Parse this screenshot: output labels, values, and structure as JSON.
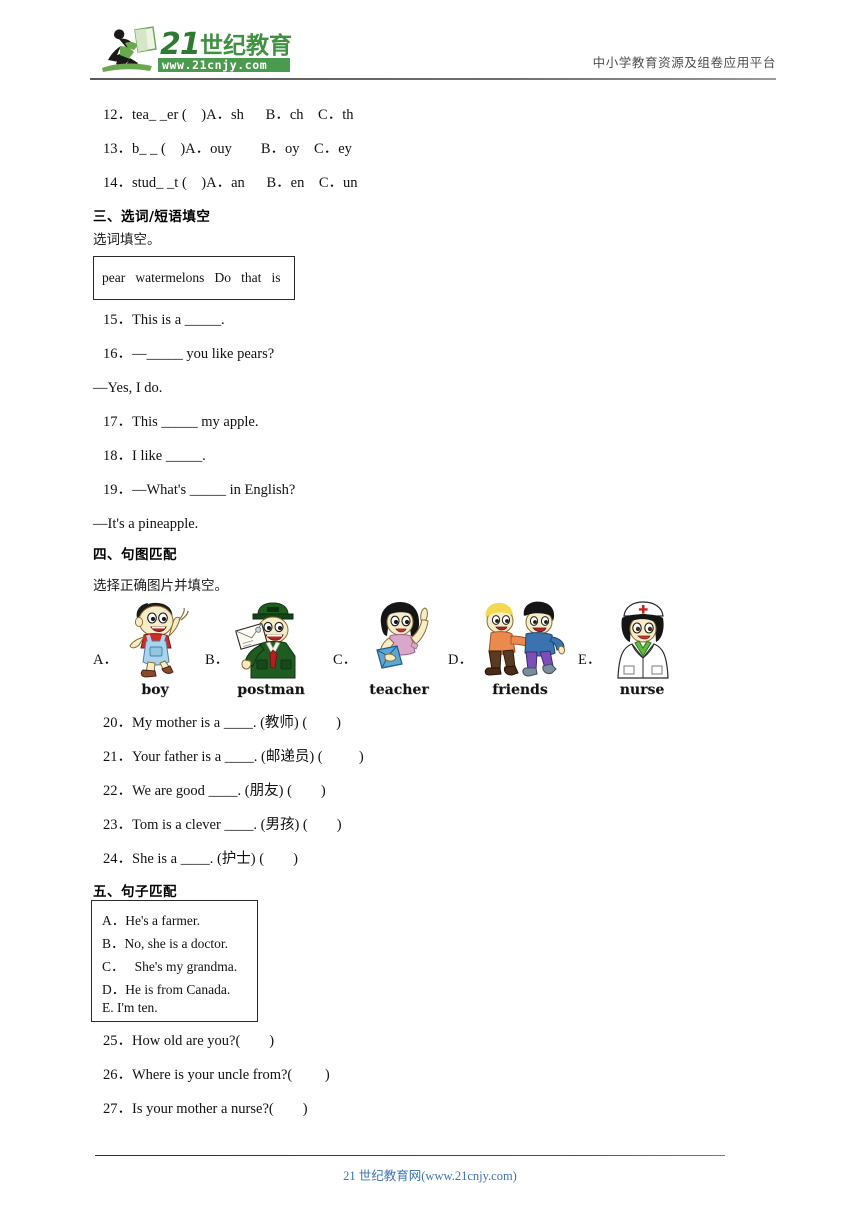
{
  "header": {
    "logo_text": "21世纪教育",
    "logo_url": "www.21cnjy.com",
    "slogan": "中小学教育资源及组卷应用平台"
  },
  "section_two_tail": {
    "questions": [
      "12．tea_ _er (    )A．sh      B．ch    C．th",
      "13．b_ _ (    )A．ouy        B．oy    C．ey",
      "14．stud_ _t (    )A．an      B．en    C．un"
    ]
  },
  "section_three": {
    "heading": "三、选词/短语填空",
    "subheading": "选词填空。",
    "wordbank": "pear   watermelons   Do   that   is",
    "items": [
      {
        "text": "15．This is a _____."
      },
      {
        "text": "16．—_____ you like pears?"
      },
      {
        "text": "—Yes, I do.",
        "continuation": true
      },
      {
        "text": "17．This _____ my apple."
      },
      {
        "text": "18．I like _____."
      },
      {
        "text": "19．—What's _____ in English?"
      },
      {
        "text": "—It's a pineapple.",
        "continuation": true
      }
    ]
  },
  "section_four": {
    "heading": "四、句图匹配",
    "subheading": "选择正确图片并填空。",
    "pictures": [
      {
        "label": "A．",
        "caption": "boy",
        "icon": "boy-illustration"
      },
      {
        "label": "B．",
        "caption": "postman",
        "icon": "postman-illustration"
      },
      {
        "label": "C．",
        "caption": "teacher",
        "icon": "teacher-illustration"
      },
      {
        "label": "D．",
        "caption": "friends",
        "icon": "friends-illustration"
      },
      {
        "label": "E．",
        "caption": "nurse",
        "icon": "nurse-illustration"
      }
    ],
    "items": [
      "20．My mother is a ____. (教师) (        )",
      "21．Your father is a ____. (邮递员) (          )",
      "22．We are good ____. (朋友) (        )",
      "23．Tom is a clever ____. (男孩) (        )",
      "24．She is a ____. (护士) (        )"
    ]
  },
  "section_five": {
    "heading": "五、句子匹配",
    "options": [
      "A．He's a farmer.",
      "B．No, she is a doctor.",
      "C．   She's my grandma.",
      "D．He is from Canada.",
      "E. I'm ten."
    ],
    "items": [
      "25．How old are you?(        )",
      "26．Where is your uncle from?(         )",
      "27．Is your mother a nurse?(        )"
    ]
  },
  "footer": {
    "text": "21 世纪教育网(www.21cnjy.com)"
  },
  "colors": {
    "logo_green": "#3f9240",
    "logo_dark_green": "#2f7a33",
    "footer_blue": "#3e74b3",
    "rule_gray": "#5a5a5a"
  }
}
